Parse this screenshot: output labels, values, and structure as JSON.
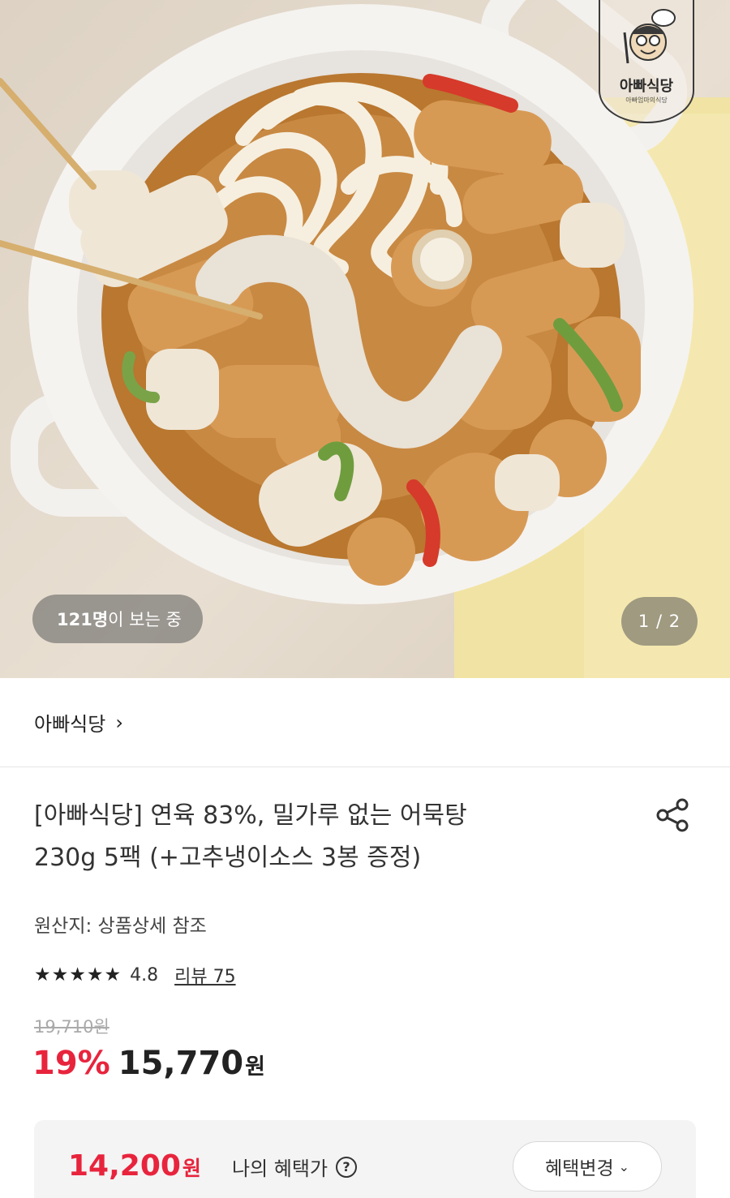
{
  "hero": {
    "logo_text": "아빠식당",
    "logo_sub": "아빠엄마의식당",
    "viewers_count": "121명",
    "viewers_suffix": "이 보는 중",
    "pager": "1 / 2"
  },
  "brand": {
    "name": "아빠식당",
    "chevron": "›"
  },
  "product": {
    "title_line1": "[아빠식당] 연육 83%, 밀가루 없는 어묵탕",
    "title_line2": "230g 5팩 (+고추냉이소스 3봉 증정)",
    "origin": "원산지: 상품상세 참조",
    "stars": "★★★★★",
    "rating": 4.8,
    "review_label": "리뷰 75",
    "original_price": "19,710원",
    "discount": "19%",
    "sale_price": "15,770",
    "sale_unit": "원"
  },
  "benefit": {
    "price": "14,200",
    "unit": "원",
    "label": "나의 혜택가",
    "help": "?",
    "change_label": "혜택변경",
    "change_chevron": "⌄"
  },
  "icons": {
    "share": "share-icon",
    "help": "question-circle-icon",
    "chevron_right": "chevron-right-icon",
    "chevron_down": "chevron-down-icon"
  },
  "colors": {
    "discount_red": "#e8243d",
    "text_dark": "#222222",
    "muted": "#aaaaaa",
    "benefit_bg": "#f4f4f4"
  }
}
